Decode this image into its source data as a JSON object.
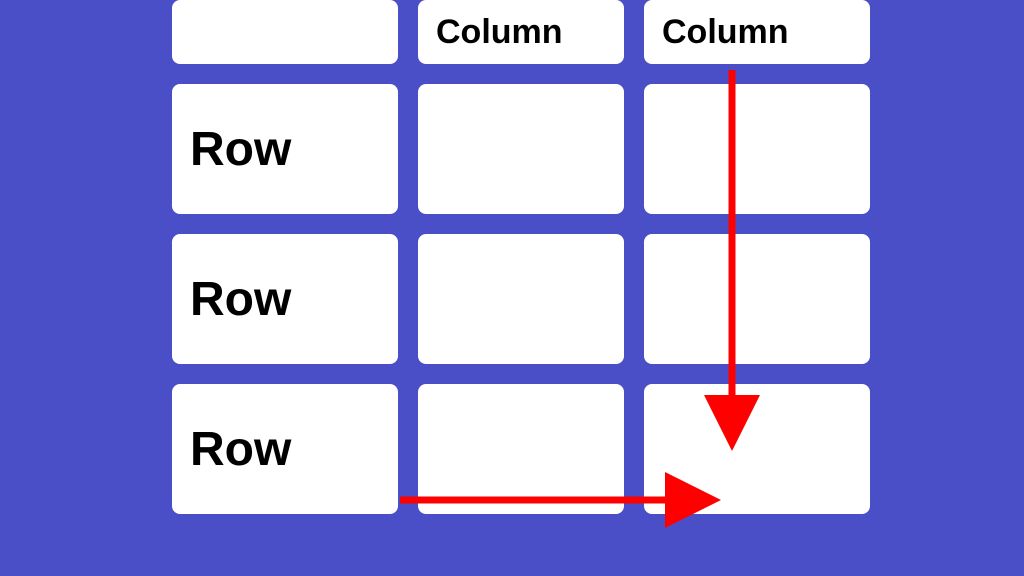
{
  "table": {
    "columns": [
      "",
      "Column",
      "Column"
    ],
    "rows": [
      "Row",
      "Row",
      "Row"
    ]
  },
  "colors": {
    "background": "#4a4fc7",
    "cell": "#ffffff",
    "arrow": "#ff0000",
    "text": "#000000"
  },
  "arrows": [
    {
      "name": "column-arrow",
      "direction": "down",
      "from": "header-col-2",
      "to": "row-3-col-2"
    },
    {
      "name": "row-arrow",
      "direction": "right",
      "from": "row-3-label",
      "to": "row-3-col-2"
    }
  ]
}
